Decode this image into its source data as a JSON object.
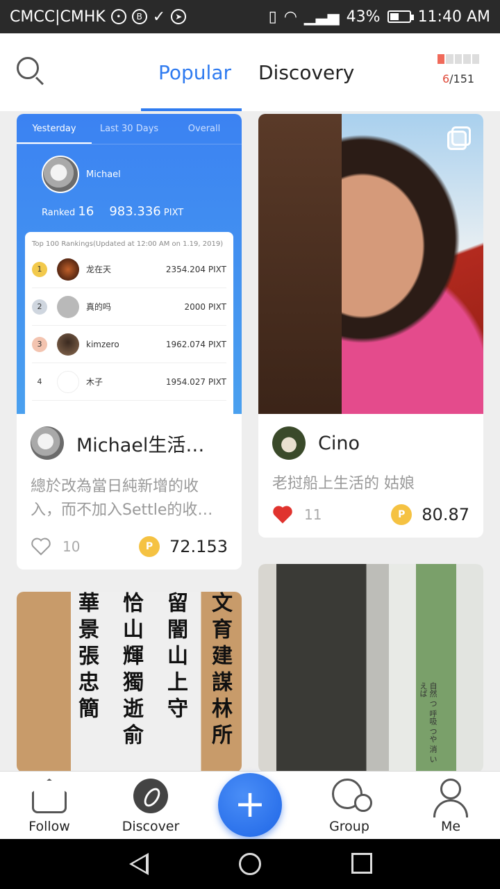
{
  "status_bar": {
    "carrier": "CMCC|CMHK",
    "battery": "43%",
    "battery_level": 0.43,
    "time": "11:40 AM",
    "icons": [
      "wechat-icon",
      "b-icon",
      "check-icon",
      "telegram-icon",
      "vibrate-icon",
      "wifi-icon",
      "signal-icon",
      "battery-icon"
    ]
  },
  "header": {
    "tabs": [
      {
        "label": "Popular",
        "active": true
      },
      {
        "label": "Discovery",
        "active": false
      }
    ],
    "progress": {
      "current": "6",
      "total": "/151"
    }
  },
  "feed": {
    "card1": {
      "ranking": {
        "tabs": [
          "Yesterday",
          "Last 30 Days",
          "Overall"
        ],
        "user": "Michael",
        "ranked_label": "Ranked",
        "rank": "16",
        "amount": "983.336",
        "unit": "PIXT",
        "list_title": "Top 100 Rankings(Updated at 12:00 AM on 1.19, 2019)",
        "rows": [
          {
            "rank": "1",
            "name": "龙在天",
            "value": "2354.204 PIXT"
          },
          {
            "rank": "2",
            "name": "真的吗",
            "value": "2000 PIXT"
          },
          {
            "rank": "3",
            "name": "kimzero",
            "value": "1962.074 PIXT"
          },
          {
            "rank": "4",
            "name": "木子",
            "value": "1954.027 PIXT"
          }
        ]
      },
      "author": "Michael生活日…",
      "description": "總於改為當日純新增的收入，而不加入Settle的收…",
      "likes": "10",
      "liked": false,
      "price": "72.153"
    },
    "card2": {
      "author": "Cino",
      "description": "老挝船上生活的 姑娘",
      "likes": "11",
      "liked": true,
      "price": "80.87"
    },
    "card3": {
      "calligraphy_columns": [
        "文育建謀林所",
        "留闇山上守",
        "恰山輝獨逝俞",
        "華景張忠簡",
        "建"
      ]
    },
    "card4": {
      "caption": "自然 つ 呼吸 つや 消 い えば"
    },
    "coin_symbol": "P"
  },
  "bottom_nav": {
    "items": [
      {
        "label": "Follow"
      },
      {
        "label": "Discover"
      },
      {
        "label": "Group"
      },
      {
        "label": "Me"
      }
    ],
    "fab": "+"
  },
  "colors": {
    "accent": "#2f7bf0",
    "heart_active": "#e0332e",
    "coin": "#f5c242"
  }
}
